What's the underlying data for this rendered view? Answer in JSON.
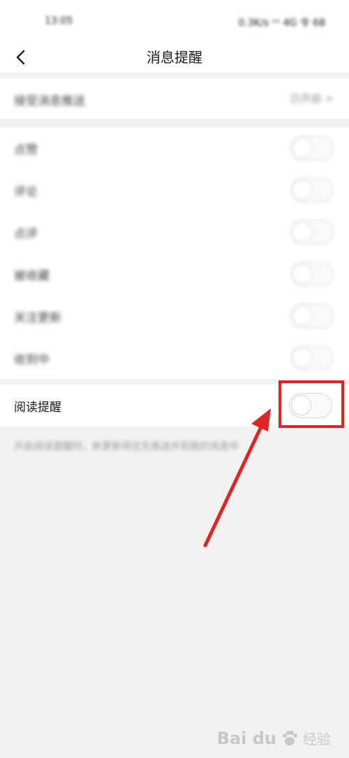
{
  "status_bar": {
    "time": "13:05",
    "right_info": "0.3K/s ᵛᵒ 4G 令 68"
  },
  "header": {
    "title": "消息提醒",
    "back_icon": "chevron-left-icon"
  },
  "top_row": {
    "label": "接受消息推送",
    "value": "已开启 >"
  },
  "settings": [
    {
      "label": "点赞"
    },
    {
      "label": "评论"
    },
    {
      "label": "点评"
    },
    {
      "label": "被收藏"
    },
    {
      "label": "关注更新"
    },
    {
      "label": "收到中"
    }
  ],
  "read_reminder": {
    "label": "阅读提醒",
    "enabled": false
  },
  "hint_text": "开启阅读提醒时，新更新将优先推送并到我的消息中",
  "watermark": {
    "brand": "Bai du",
    "sub": "经验"
  },
  "colors": {
    "accent_red": "#e02424",
    "background": "#f2f2f2"
  }
}
